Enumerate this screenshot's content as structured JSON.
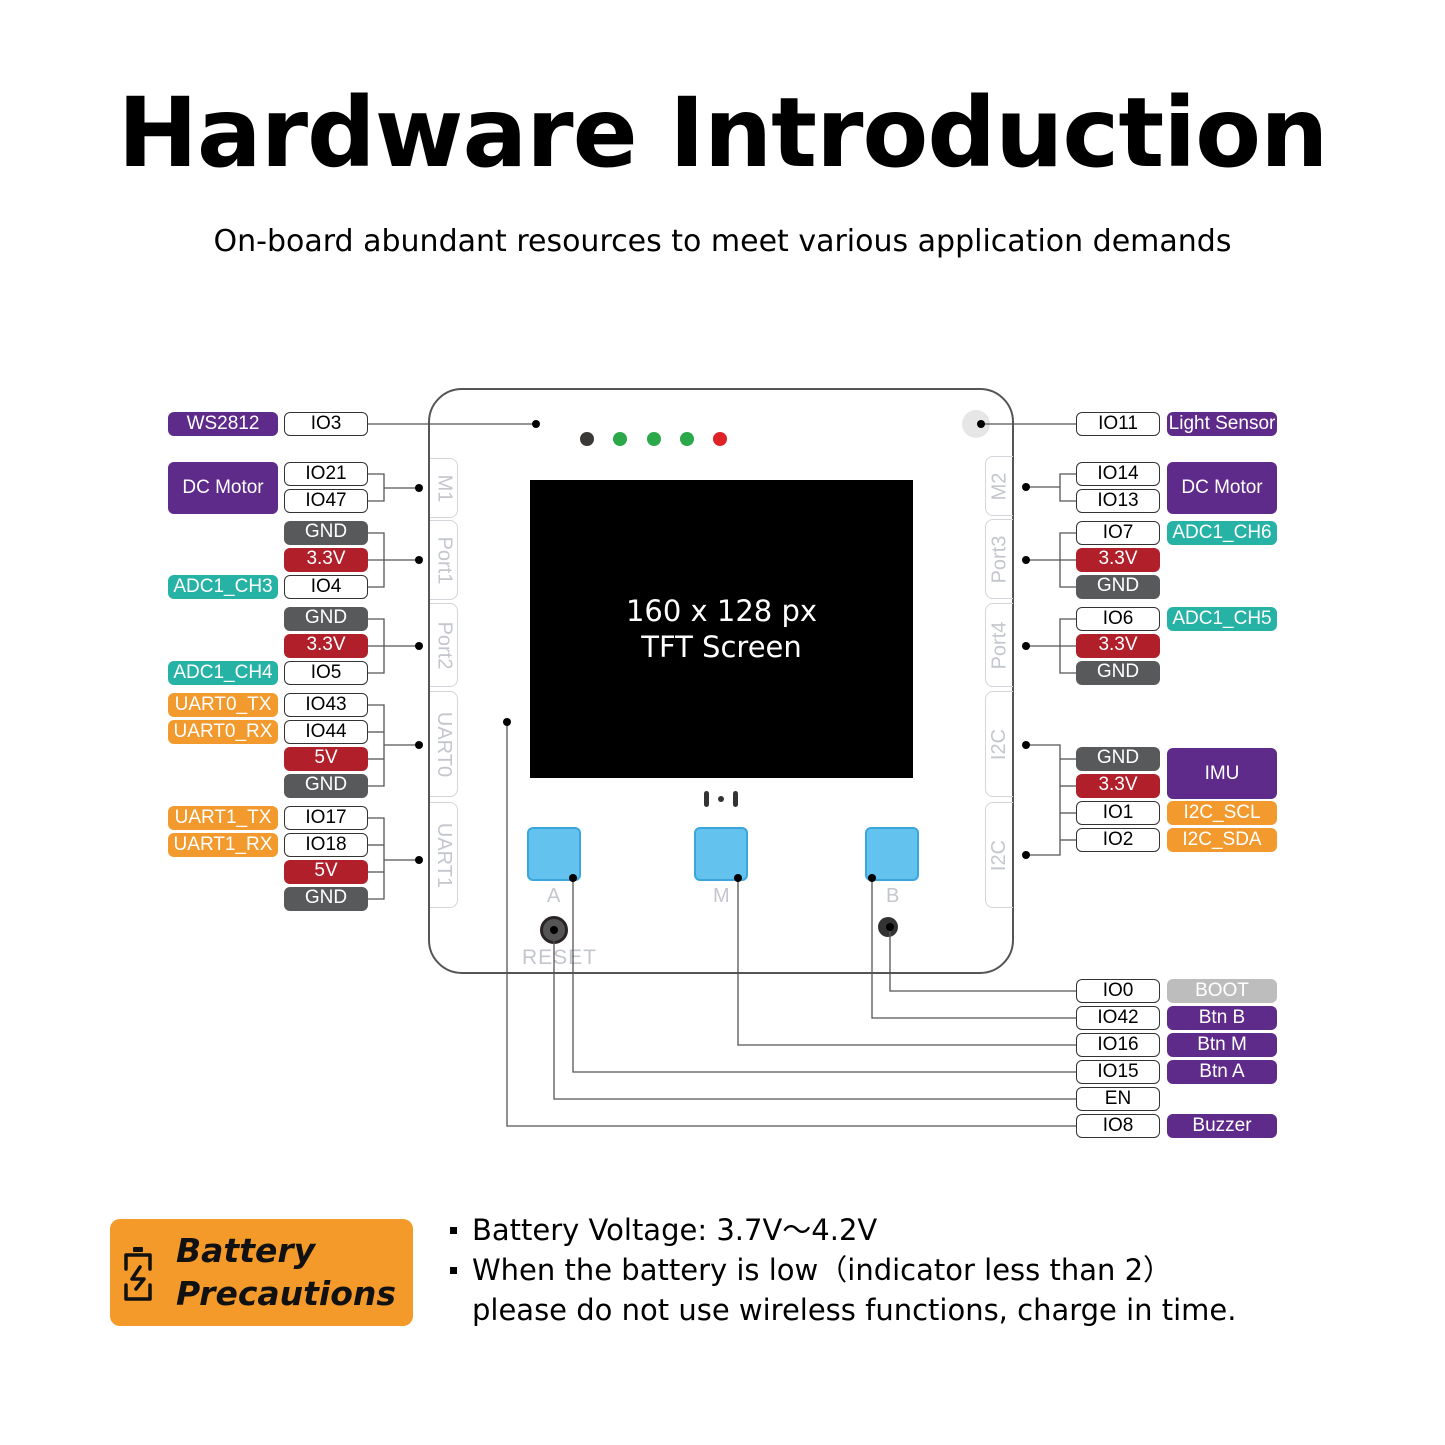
{
  "header": {
    "title": "Hardware Introduction",
    "subtitle": "On-board abundant resources to meet various application demands"
  },
  "screen": {
    "line1": "160 x 128 px",
    "line2": "TFT Screen"
  },
  "board": {
    "left_tabs": [
      "M1",
      "Port1",
      "Port2",
      "UART0",
      "UART1"
    ],
    "right_tabs": [
      "M2",
      "Port3",
      "Port4",
      "I2C",
      "I2C"
    ],
    "buttons": [
      "A",
      "M",
      "B"
    ],
    "reset_label": "RESET",
    "leds": [
      "#3a3737",
      "#2aa84a",
      "#2aa84a",
      "#2aa84a",
      "#dd2228"
    ]
  },
  "left_pins": {
    "ws2812": {
      "pin": "IO3",
      "func": "WS2812"
    },
    "m1": {
      "pins": [
        "IO21",
        "IO47"
      ],
      "func": "DC Motor"
    },
    "port1": {
      "pins": [
        "GND",
        "3.3V",
        "IO4"
      ],
      "func": "ADC1_CH3"
    },
    "port2": {
      "pins": [
        "GND",
        "3.3V",
        "IO5"
      ],
      "func": "ADC1_CH4"
    },
    "uart0": {
      "pins": [
        "IO43",
        "IO44",
        "5V",
        "GND"
      ],
      "funcs": [
        "UART0_TX",
        "UART0_RX"
      ]
    },
    "uart1": {
      "pins": [
        "IO17",
        "IO18",
        "5V",
        "GND"
      ],
      "funcs": [
        "UART1_TX",
        "UART1_RX"
      ]
    }
  },
  "right_pins": {
    "light": {
      "pin": "IO11",
      "func": "Light Sensor"
    },
    "m2": {
      "pins": [
        "IO14",
        "IO13"
      ],
      "func": "DC Motor"
    },
    "port3": {
      "pins": [
        "IO7",
        "3.3V",
        "GND"
      ],
      "func": "ADC1_CH6"
    },
    "port4": {
      "pins": [
        "IO6",
        "3.3V",
        "GND"
      ],
      "func": "ADC1_CH5"
    },
    "i2c": {
      "pins": [
        "GND",
        "3.3V",
        "IO1",
        "IO2"
      ],
      "func": "IMU",
      "funcs": [
        "I2C_SCL",
        "I2C_SDA"
      ]
    }
  },
  "bottom_pins": [
    {
      "pin": "IO0",
      "func": "BOOT"
    },
    {
      "pin": "IO42",
      "func": "Btn B"
    },
    {
      "pin": "IO16",
      "func": "Btn M"
    },
    {
      "pin": "IO15",
      "func": "Btn A"
    },
    {
      "pin": "EN",
      "func": ""
    },
    {
      "pin": "IO8",
      "func": "Buzzer"
    }
  ],
  "battery": {
    "title_line1": "Battery",
    "title_line2": "Precautions",
    "notes": [
      "Battery Voltage:  3.7V～4.2V",
      "When the battery is low（indicator less than 2）",
      "please do not use wireless functions, charge in time."
    ]
  },
  "colors": {
    "purple": "#5f2b8a",
    "teal": "#27b2a6",
    "orange": "#f29a2e",
    "red": "#b01f2a",
    "gray": "#58595b",
    "button_blue": "#63c2ee"
  }
}
